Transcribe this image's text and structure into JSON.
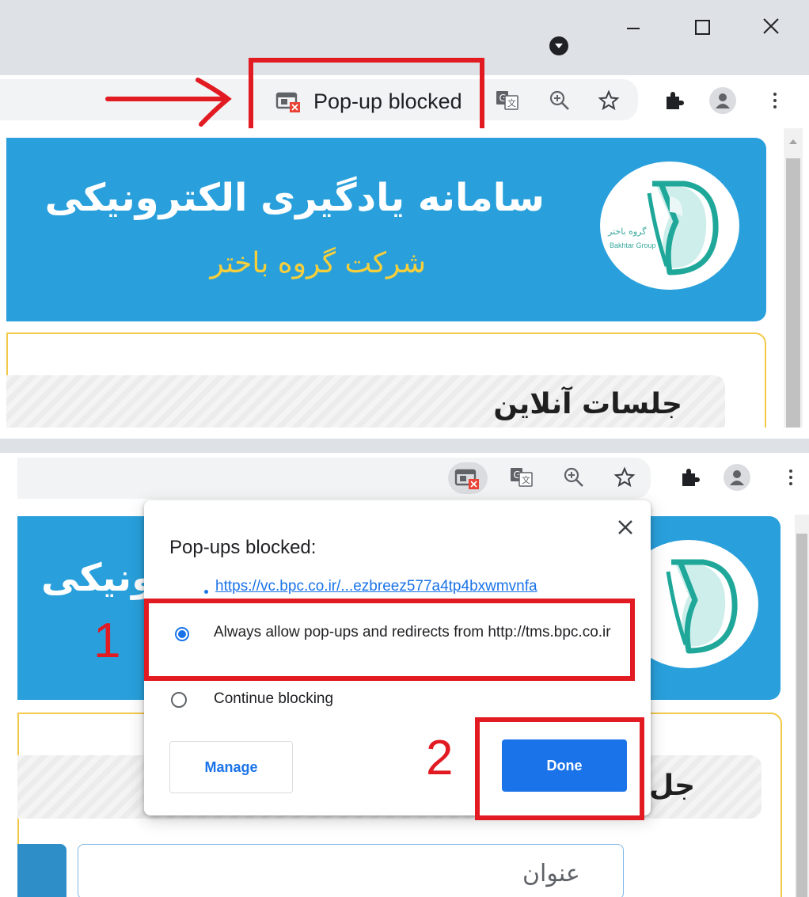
{
  "top": {
    "chip_label": "Pop-up blocked",
    "banner_title": "سامانه یادگیری الکترونیکی",
    "banner_subtitle": "شرکت گروه باختر",
    "section_title": "جلسات آنلاین"
  },
  "bottom": {
    "banner_title_partial": "ونیکی",
    "section_title_partial": "جل",
    "search_placeholder": "عنوان",
    "popup": {
      "title": "Pop-ups blocked:",
      "link": "https://vc.bpc.co.ir/...ezbreez577a4tp4bxwmvnfa",
      "option_allow": "Always allow pop-ups and redirects from http://tms.bpc.co.ir",
      "option_continue": "Continue blocking",
      "manage_label": "Manage",
      "done_label": "Done"
    },
    "step_labels": [
      "1",
      "2"
    ]
  },
  "logo": {
    "text_fa": "گروه باختر",
    "text_en": "Bakhtar Group"
  },
  "colors": {
    "banner": "#29a0dc",
    "subtitle": "#f6cf3b",
    "annotation": "#e21a22",
    "accent": "#1a73e8"
  },
  "icons": [
    "popup-blocked-icon",
    "translate-icon",
    "zoom-icon",
    "star-icon",
    "extensions-icon",
    "profile-icon",
    "menu-icon",
    "minimize-icon",
    "maximize-icon",
    "close-icon",
    "arrow-icon"
  ]
}
